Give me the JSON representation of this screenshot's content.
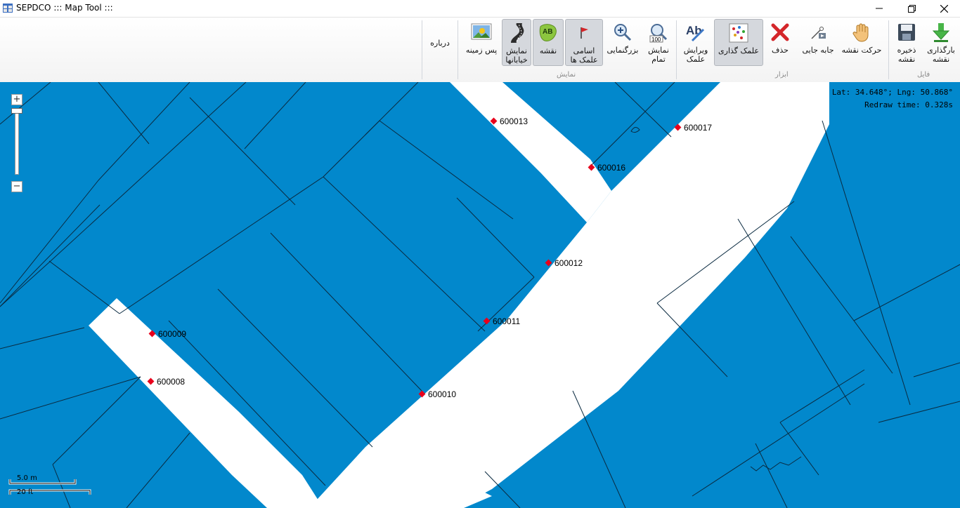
{
  "window": {
    "title": "SEPDCO ::: Map Tool :::",
    "controls": [
      "minimize",
      "restore",
      "close"
    ]
  },
  "ribbon": {
    "groups": {
      "file": "فایل",
      "tools": "ابزار",
      "view": "نمایش"
    },
    "buttons": {
      "load_map": "بارگذاری\nنقشه",
      "save_map": "ذخیره\nنقشه",
      "pan": "حرکت نقشه",
      "move": "جابه جایی",
      "delete": "حذف",
      "place_marker": "علمک گذاری",
      "edit_marker": "ویرایش\nعلمک",
      "full_view": "نمایش\nتمام",
      "zoom": "بزرگنمایی",
      "marker_names": "اسامی\nعلمک ها",
      "map": "نقشه",
      "show_streets": "نمایش\nخیابانها",
      "background": "پس زمینه",
      "about": "درباره"
    },
    "icons": {
      "load_map": "download-arrow-icon",
      "save_map": "floppy-disk-icon",
      "pan": "hand-icon",
      "move": "move-node-icon",
      "delete": "red-x-icon",
      "place_marker": "dots-grid-icon",
      "edit_marker": "ab-pencil-icon",
      "full_view": "magnifier-100-icon",
      "zoom": "magnifier-plus-icon",
      "marker_names": "red-flag-icon",
      "map": "ab-map-icon",
      "show_streets": "road-icon",
      "background": "landscape-image-icon"
    },
    "active": [
      "place_marker",
      "marker_names",
      "map",
      "show_streets"
    ]
  },
  "map": {
    "colors": {
      "parcel": "#0288cc",
      "road": "#ffffff",
      "marker": "#e8001c"
    },
    "readout": {
      "latlng": "Lat: 34.648°; Lng: 50.868°",
      "redraw": "Redraw time: 0.328s"
    },
    "markers": [
      "600013",
      "600017",
      "600016",
      "600012",
      "600011",
      "600009",
      "600008",
      "600010"
    ],
    "zoom": {
      "plus": "+",
      "minus": "−",
      "level": 0.97
    },
    "scale": {
      "metric": "5.0 m",
      "imperial": "20 ft"
    }
  }
}
